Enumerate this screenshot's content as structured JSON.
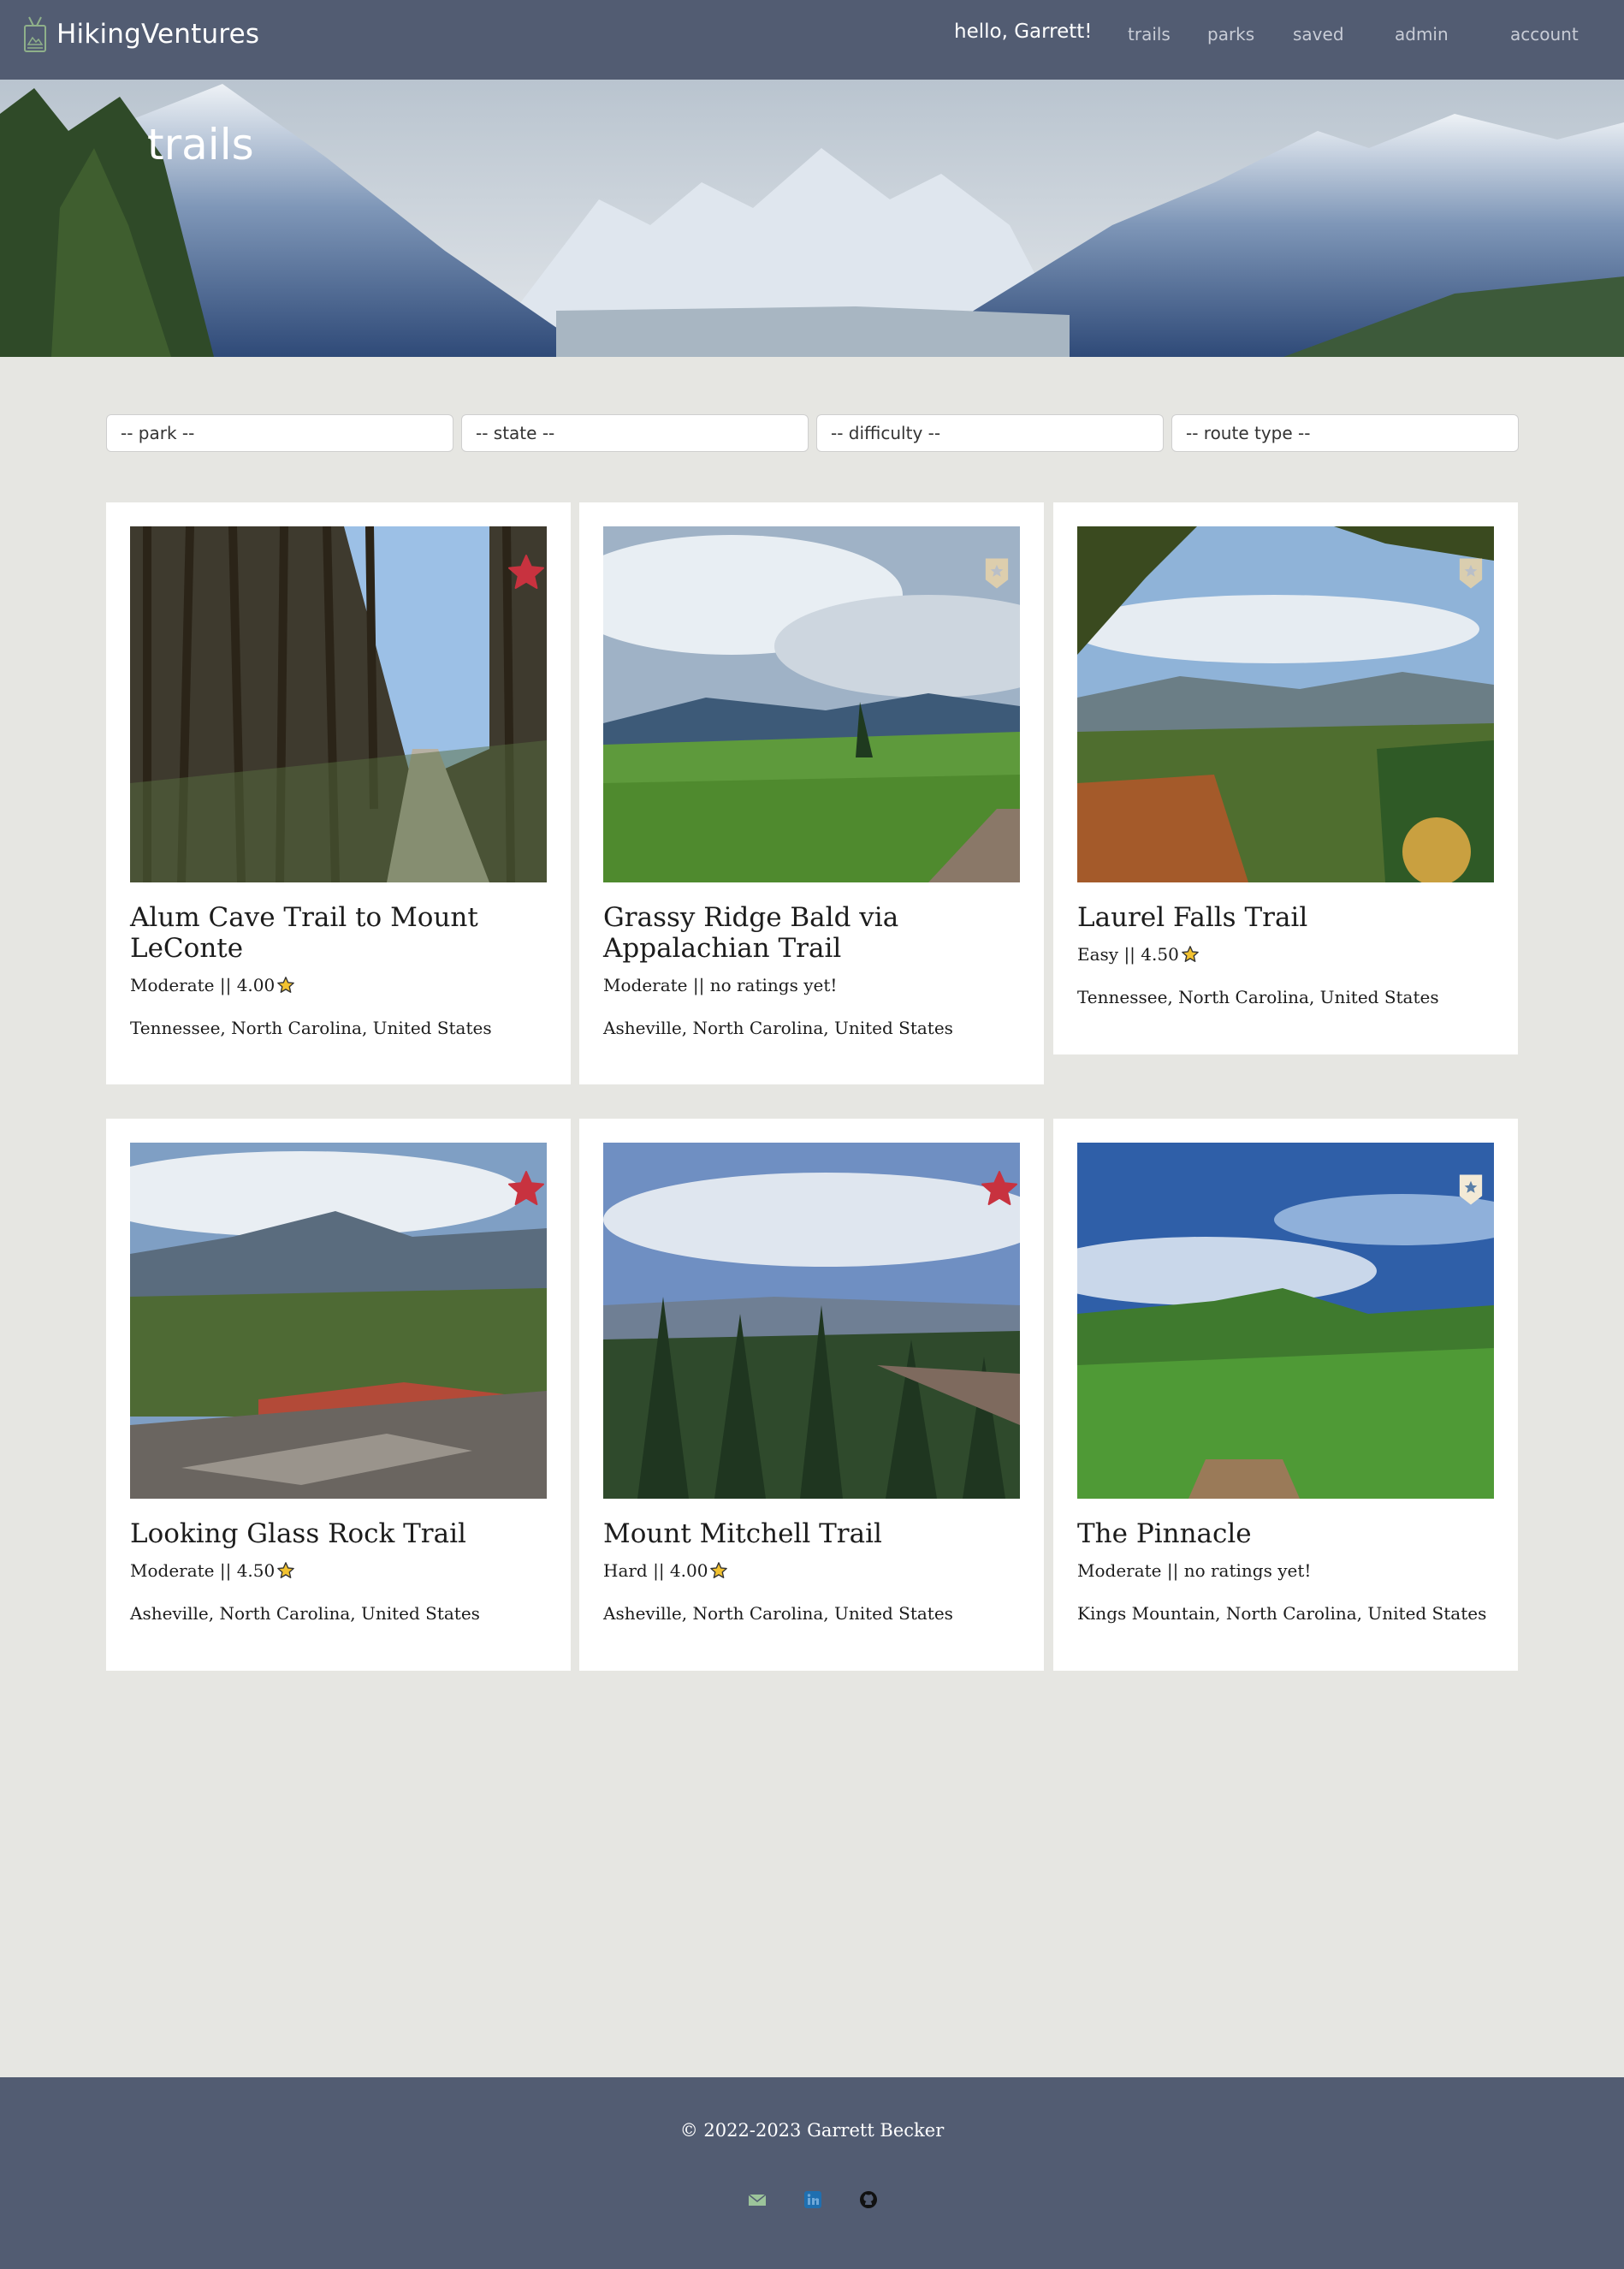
{
  "navbar": {
    "brand": "HikingVentures",
    "greeting": "hello, Garrett!",
    "links": [
      "trails",
      "parks",
      "saved",
      "admin",
      "account"
    ]
  },
  "hero": {
    "title": "trails"
  },
  "filters": {
    "park": "-- park --",
    "state": "-- state --",
    "difficulty": "-- difficulty --",
    "route_type": "-- route type --"
  },
  "trails": [
    {
      "name": "Alum Cave Trail to Mount LeConte",
      "difficulty": "Moderate",
      "rating_text": "Moderate || 4.00",
      "rating": 4.0,
      "has_star": true,
      "location": "Tennessee, North Carolina, United States",
      "favorited": true
    },
    {
      "name": "Grassy Ridge Bald via Appalachian Trail",
      "difficulty": "Moderate",
      "rating_text": "Moderate || no ratings yet!",
      "rating": null,
      "has_star": false,
      "location": "Asheville, North Carolina, United States",
      "favorited": false
    },
    {
      "name": "Laurel Falls Trail",
      "difficulty": "Easy",
      "rating_text": "Easy || 4.50",
      "rating": 4.5,
      "has_star": true,
      "location": "Tennessee, North Carolina, United States",
      "favorited": false
    },
    {
      "name": "Looking Glass Rock Trail",
      "difficulty": "Moderate",
      "rating_text": "Moderate || 4.50",
      "rating": 4.5,
      "has_star": true,
      "location": "Asheville, North Carolina, United States",
      "favorited": true
    },
    {
      "name": "Mount Mitchell Trail",
      "difficulty": "Hard",
      "rating_text": "Hard || 4.00",
      "rating": 4.0,
      "has_star": true,
      "location": "Asheville, North Carolina, United States",
      "favorited": true
    },
    {
      "name": "The Pinnacle",
      "difficulty": "Moderate",
      "rating_text": "Moderate || no ratings yet!",
      "rating": null,
      "has_star": false,
      "location": "Kings Mountain, North Carolina, United States",
      "favorited": false
    }
  ],
  "footer": {
    "copyright": "© 2022-2023 Garrett Becker",
    "icons": [
      "email-icon",
      "linkedin-icon",
      "github-icon"
    ]
  },
  "colors": {
    "nav_bg": "#525c72",
    "page_bg": "#e6e6e2",
    "fav_red": "#c8323f",
    "save_tan": "#e8d2a8",
    "star_gold": "#f2c230"
  }
}
